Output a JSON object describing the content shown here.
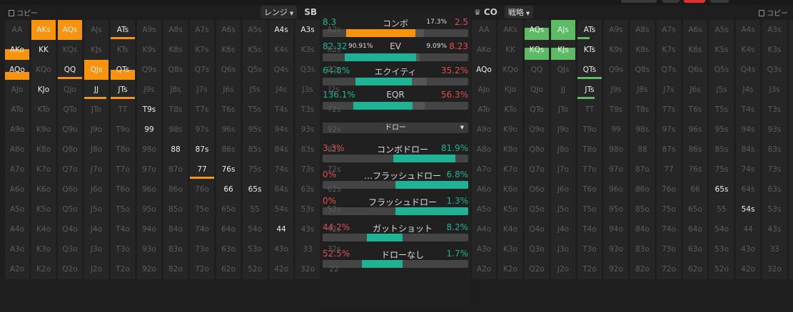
{
  "colors": {
    "orange": "#f7930c",
    "green": "#5dbb63",
    "teal": "#1db394",
    "red": "#e34b4b"
  },
  "left": {
    "copy_label": "コピー",
    "dropdown_label": "レンジ",
    "position": "SB"
  },
  "right": {
    "position": "CO",
    "dropdown_label": "戦略",
    "copy_label": "コピー",
    "crown_icon": "crown-icon"
  },
  "hands": [
    [
      "AA",
      "AKs",
      "AQs",
      "AJs",
      "ATs",
      "A9s",
      "A8s",
      "A7s",
      "A6s",
      "A5s",
      "A4s",
      "A3s",
      "A2s"
    ],
    [
      "AKo",
      "KK",
      "KQs",
      "KJs",
      "KTs",
      "K9s",
      "K8s",
      "K7s",
      "K6s",
      "K5s",
      "K4s",
      "K3s",
      "K2s"
    ],
    [
      "AQo",
      "KQo",
      "QQ",
      "QJs",
      "QTs",
      "Q9s",
      "Q8s",
      "Q7s",
      "Q6s",
      "Q5s",
      "Q4s",
      "Q3s",
      "Q2s"
    ],
    [
      "AJo",
      "KJo",
      "QJo",
      "JJ",
      "JTs",
      "J9s",
      "J8s",
      "J7s",
      "J6s",
      "J5s",
      "J4s",
      "J3s",
      "J2s"
    ],
    [
      "ATo",
      "KTo",
      "QTo",
      "JTo",
      "TT",
      "T9s",
      "T8s",
      "T7s",
      "T6s",
      "T5s",
      "T4s",
      "T3s",
      "T2s"
    ],
    [
      "A9o",
      "K9o",
      "Q9o",
      "J9o",
      "T9o",
      "99",
      "98s",
      "97s",
      "96s",
      "95s",
      "94s",
      "93s",
      "92s"
    ],
    [
      "A8o",
      "K8o",
      "Q8o",
      "J8o",
      "T8o",
      "98o",
      "88",
      "87s",
      "86s",
      "85s",
      "84s",
      "83s",
      "82s"
    ],
    [
      "A7o",
      "K7o",
      "Q7o",
      "J7o",
      "T7o",
      "97o",
      "87o",
      "77",
      "76s",
      "75s",
      "74s",
      "73s",
      "72s"
    ],
    [
      "A6o",
      "K6o",
      "Q6o",
      "J6o",
      "T6o",
      "96o",
      "86o",
      "76o",
      "66",
      "65s",
      "64s",
      "63s",
      "62s"
    ],
    [
      "A5o",
      "K5o",
      "Q5o",
      "J5o",
      "T5o",
      "95o",
      "85o",
      "75o",
      "65o",
      "55",
      "54s",
      "53s",
      "52s"
    ],
    [
      "A4o",
      "K4o",
      "Q4o",
      "J4o",
      "T4o",
      "94o",
      "84o",
      "74o",
      "64o",
      "54o",
      "44",
      "43s",
      "42s"
    ],
    [
      "A3o",
      "K3o",
      "Q3o",
      "J3o",
      "T3o",
      "93o",
      "83o",
      "73o",
      "63o",
      "53o",
      "43o",
      "33",
      "32s"
    ],
    [
      "A2o",
      "K2o",
      "Q2o",
      "J2o",
      "T2o",
      "92o",
      "82o",
      "72o",
      "62o",
      "52o",
      "42o",
      "32o",
      "22"
    ]
  ],
  "left_marks": [
    {
      "hand": "AKs",
      "style": "full",
      "frac": 1
    },
    {
      "hand": "AQs",
      "style": "full",
      "frac": 1
    },
    {
      "hand": "ATs",
      "style": "bar",
      "frac": 1
    },
    {
      "hand": "AKo",
      "style": "bottom",
      "frac": 0.55
    },
    {
      "hand": "KK",
      "style": "text"
    },
    {
      "hand": "AQo",
      "style": "bottom",
      "frac": 0.4
    },
    {
      "hand": "QQ",
      "style": "bar",
      "frac": 1
    },
    {
      "hand": "QJs",
      "style": "full",
      "frac": 1
    },
    {
      "hand": "QTs",
      "style": "bottom",
      "frac": 0.5
    },
    {
      "hand": "KJo",
      "style": "text"
    },
    {
      "hand": "JJ",
      "style": "bar",
      "frac": 0.9
    },
    {
      "hand": "JTs",
      "style": "bar",
      "frac": 1
    },
    {
      "hand": "T9s",
      "style": "text"
    },
    {
      "hand": "99",
      "style": "text"
    },
    {
      "hand": "88",
      "style": "text"
    },
    {
      "hand": "87s",
      "style": "text"
    },
    {
      "hand": "77",
      "style": "bar",
      "frac": 1
    },
    {
      "hand": "76s",
      "style": "text"
    },
    {
      "hand": "66",
      "style": "text"
    },
    {
      "hand": "65s",
      "style": "text"
    },
    {
      "hand": "44",
      "style": "text"
    },
    {
      "hand": "A4s",
      "style": "text"
    },
    {
      "hand": "A3s",
      "style": "text"
    }
  ],
  "right_marks": [
    {
      "hand": "AQs",
      "style": "bottom",
      "frac": 0.6
    },
    {
      "hand": "AJs",
      "style": "bottom",
      "frac": 1
    },
    {
      "hand": "ATs",
      "style": "bar",
      "frac": 0.5
    },
    {
      "hand": "KQs",
      "style": "bottom",
      "frac": 0.6
    },
    {
      "hand": "KJs",
      "style": "bottom",
      "frac": 0.6
    },
    {
      "hand": "KTs",
      "style": "text"
    },
    {
      "hand": "AQo",
      "style": "text"
    },
    {
      "hand": "QTs",
      "style": "bar",
      "frac": 1
    },
    {
      "hand": "JTs",
      "style": "bar",
      "frac": 0.7
    },
    {
      "hand": "65s",
      "style": "text"
    },
    {
      "hand": "54s",
      "style": "text"
    }
  ],
  "stats": [
    {
      "label": "コンボ",
      "left": "8.3",
      "right": "2.5",
      "left_pct": "",
      "right_pct": "17.3%",
      "lv": 0.8,
      "rv": 0.2,
      "lcolor": "orange"
    },
    {
      "label": "EV",
      "left": "82.32",
      "right": "8.23",
      "left_pct": "90.91%",
      "right_pct": "9.09%",
      "lv": 0.82,
      "rv": 0.09,
      "lcolor": "teal"
    },
    {
      "label": "エクイティ",
      "left": "64.8%",
      "right": "35.2%",
      "left_pct": "",
      "right_pct": "",
      "lv": 0.648,
      "rv": 0.352,
      "lcolor": "teal"
    },
    {
      "label": "EQR",
      "left": "136.1%",
      "right": "56.3%",
      "left_pct": "",
      "right_pct": "",
      "lv": 0.68,
      "rv": 0.28,
      "lcolor": "teal"
    }
  ],
  "draw_dropdown_label": "ドロー",
  "draws": [
    {
      "label": "コンボドロー",
      "left": "3.3%",
      "right": "81.9%",
      "lv": 0.033,
      "rv": 0.819
    },
    {
      "label": "…フラッシュドロー",
      "left": "0%",
      "right": "6.8%",
      "lv": 0,
      "rv": 1
    },
    {
      "label": "フラッシュドロー",
      "left": "0%",
      "right": "1.3%",
      "lv": 0,
      "rv": 1
    },
    {
      "label": "ガットショット",
      "left": "44.2%",
      "right": "8.2%",
      "lv": 0.442,
      "rv": 0.082
    },
    {
      "label": "ドローなし",
      "left": "52.5%",
      "right": "1.7%",
      "lv": 0.525,
      "rv": 0.017
    }
  ]
}
